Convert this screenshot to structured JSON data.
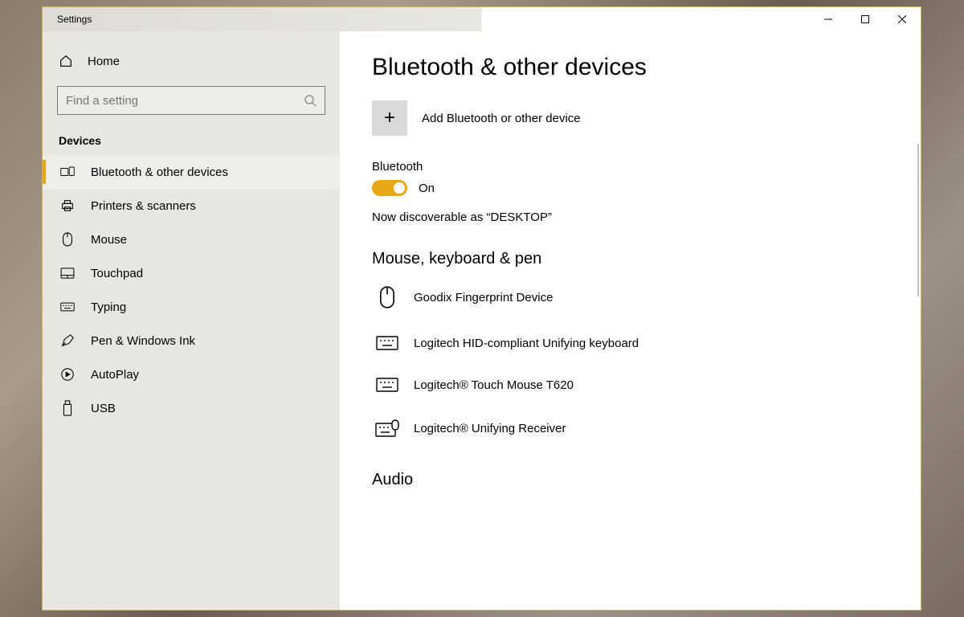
{
  "window_title": "Settings",
  "sidebar": {
    "home": "Home",
    "search_placeholder": "Find a setting",
    "section": "Devices",
    "items": [
      {
        "label": "Bluetooth & other devices",
        "icon": "bluetooth-devices"
      },
      {
        "label": "Printers & scanners",
        "icon": "printer"
      },
      {
        "label": "Mouse",
        "icon": "mouse"
      },
      {
        "label": "Touchpad",
        "icon": "touchpad"
      },
      {
        "label": "Typing",
        "icon": "keyboard"
      },
      {
        "label": "Pen & Windows Ink",
        "icon": "pen"
      },
      {
        "label": "AutoPlay",
        "icon": "autoplay"
      },
      {
        "label": "USB",
        "icon": "usb"
      }
    ]
  },
  "content": {
    "heading": "Bluetooth & other devices",
    "add_device": "Add Bluetooth or other device",
    "bluetooth_label": "Bluetooth",
    "bluetooth_state": "On",
    "discoverable": "Now discoverable as “DESKTOP”",
    "group_input": "Mouse, keyboard & pen",
    "devices": [
      {
        "name": "Goodix Fingerprint Device",
        "icon": "mouse"
      },
      {
        "name": "Logitech HID-compliant Unifying keyboard",
        "icon": "keyboard"
      },
      {
        "name": "Logitech® Touch Mouse T620",
        "icon": "keyboard"
      },
      {
        "name": "Logitech® Unifying Receiver",
        "icon": "keyboard-mouse"
      }
    ],
    "group_audio": "Audio"
  }
}
